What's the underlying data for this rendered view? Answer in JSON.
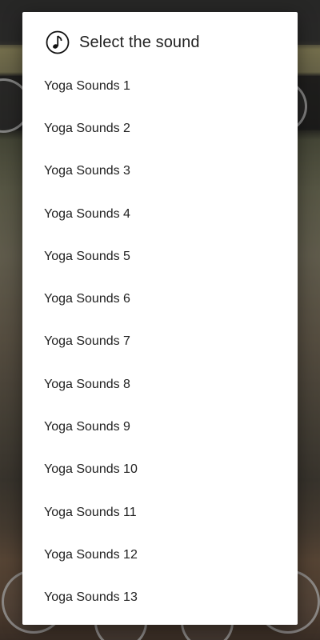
{
  "dialog": {
    "title": "Select the sound",
    "icon": "music-note-icon",
    "items": [
      {
        "label": "Yoga Sounds 1"
      },
      {
        "label": "Yoga Sounds 2"
      },
      {
        "label": "Yoga Sounds 3"
      },
      {
        "label": "Yoga Sounds 4"
      },
      {
        "label": "Yoga Sounds 5"
      },
      {
        "label": "Yoga Sounds 6"
      },
      {
        "label": "Yoga Sounds 7"
      },
      {
        "label": "Yoga Sounds 8"
      },
      {
        "label": "Yoga Sounds 9"
      },
      {
        "label": "Yoga Sounds 10"
      },
      {
        "label": "Yoga Sounds 11"
      },
      {
        "label": "Yoga Sounds 12"
      },
      {
        "label": "Yoga Sounds 13"
      }
    ]
  },
  "colors": {
    "dialog_background": "#ffffff",
    "text": "#222222",
    "scrim": "#000000"
  }
}
